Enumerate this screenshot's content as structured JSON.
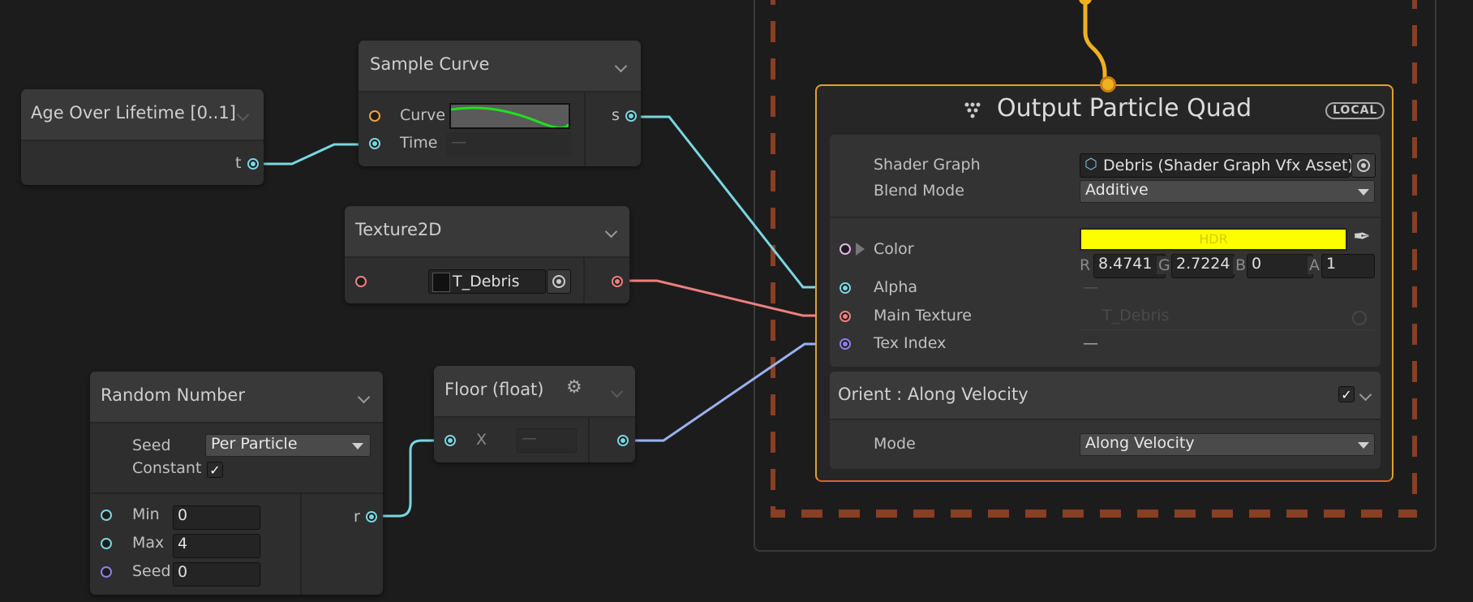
{
  "nodes": {
    "age": {
      "title": "Age Over Lifetime [0..1]",
      "out_port": "t"
    },
    "sample_curve": {
      "title": "Sample Curve",
      "in_curve": "Curve",
      "in_time": "Time",
      "time_value": "—",
      "out_port": "s"
    },
    "texture2d": {
      "title": "Texture2D",
      "texture_value": "T_Debris"
    },
    "random": {
      "title": "Random Number",
      "seed_label": "Seed",
      "seed_mode": "Per Particle",
      "constant_label": "Constant",
      "constant_checked": "✓",
      "min_label": "Min",
      "min_value": "0",
      "max_label": "Max",
      "max_value": "4",
      "seed2_label": "Seed",
      "seed2_value": "0",
      "out_port": "r"
    },
    "floor": {
      "title": "Floor (float)",
      "in_x": "X",
      "x_value": "—"
    }
  },
  "output": {
    "title": "Output Particle Quad",
    "badge": "LOCAL",
    "shader_graph_label": "Shader Graph",
    "shader_graph_value": "Debris (Shader Graph Vfx Asset)",
    "blend_mode_label": "Blend Mode",
    "blend_mode_value": "Additive",
    "color_label": "Color",
    "color_hdr": "HDR",
    "color_swatch": "#ffff00",
    "r_label": "R",
    "r_value": "8.4741",
    "g_label": "G",
    "g_value": "2.7224",
    "b_label": "B",
    "b_value": "0",
    "a_label": "A",
    "a_value": "1",
    "alpha_label": "Alpha",
    "alpha_value": "—",
    "main_texture_label": "Main Texture",
    "main_texture_value": "T_Debris",
    "tex_index_label": "Tex Index",
    "tex_index_value": "—",
    "block_title": "Orient : Along Velocity",
    "block_checked": "✓",
    "mode_label": "Mode",
    "mode_value": "Along Velocity"
  },
  "colors": {
    "float_port": "#7ad6e0",
    "texture_port": "#ef7f7f",
    "uint_port": "#8f80e8",
    "curve_port": "#f0a040",
    "flow": "#f0b020",
    "output_border": "#e0a030",
    "dash": "#8a3e22"
  }
}
